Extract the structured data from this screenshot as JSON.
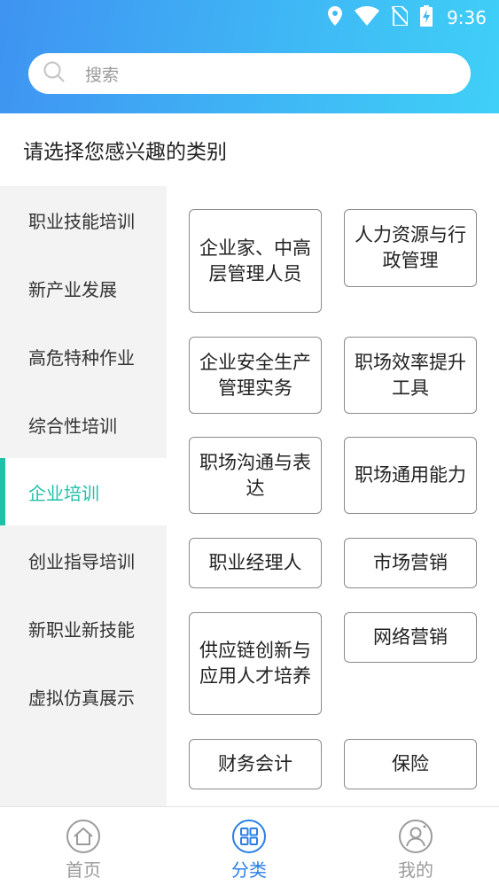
{
  "status_bar": {
    "time": "9:36",
    "icons": [
      "location-icon",
      "wifi-icon",
      "no-sim-icon",
      "battery-charging-icon"
    ]
  },
  "search": {
    "placeholder": "搜索",
    "icon": "search-icon"
  },
  "prompt": "请选择您感兴趣的类别",
  "sidebar": {
    "items": [
      {
        "label": "职业技能培训",
        "active": false
      },
      {
        "label": "新产业发展",
        "active": false
      },
      {
        "label": "高危特种作业",
        "active": false
      },
      {
        "label": "综合性培训",
        "active": false
      },
      {
        "label": "企业培训",
        "active": true
      },
      {
        "label": "创业指导培训",
        "active": false
      },
      {
        "label": "新职业新技能",
        "active": false
      },
      {
        "label": "虚拟仿真展示",
        "active": false
      }
    ]
  },
  "categories": [
    {
      "label": "企业家、中高层管理人员"
    },
    {
      "label": "人力资源与行政管理"
    },
    {
      "label": "企业安全生产管理实务"
    },
    {
      "label": "职场效率提升工具"
    },
    {
      "label": "职场沟通与表达"
    },
    {
      "label": "职场通用能力"
    },
    {
      "label": "职业经理人"
    },
    {
      "label": "市场营销"
    },
    {
      "label": "供应链创新与应用人才培养"
    },
    {
      "label": "网络营销"
    },
    {
      "label": "财务会计"
    },
    {
      "label": "保险"
    }
  ],
  "bottom_nav": {
    "items": [
      {
        "label": "首页",
        "icon": "home-icon",
        "active": false
      },
      {
        "label": "分类",
        "icon": "grid-icon",
        "active": true
      },
      {
        "label": "我的",
        "icon": "user-icon",
        "active": false
      }
    ]
  },
  "colors": {
    "header_gradient_start": "#3f93f2",
    "header_gradient_end": "#3fd0f7",
    "active_sidebar": "#1fc0a8",
    "active_nav": "#2a7fe6",
    "inactive_nav": "#9b9b9b"
  }
}
